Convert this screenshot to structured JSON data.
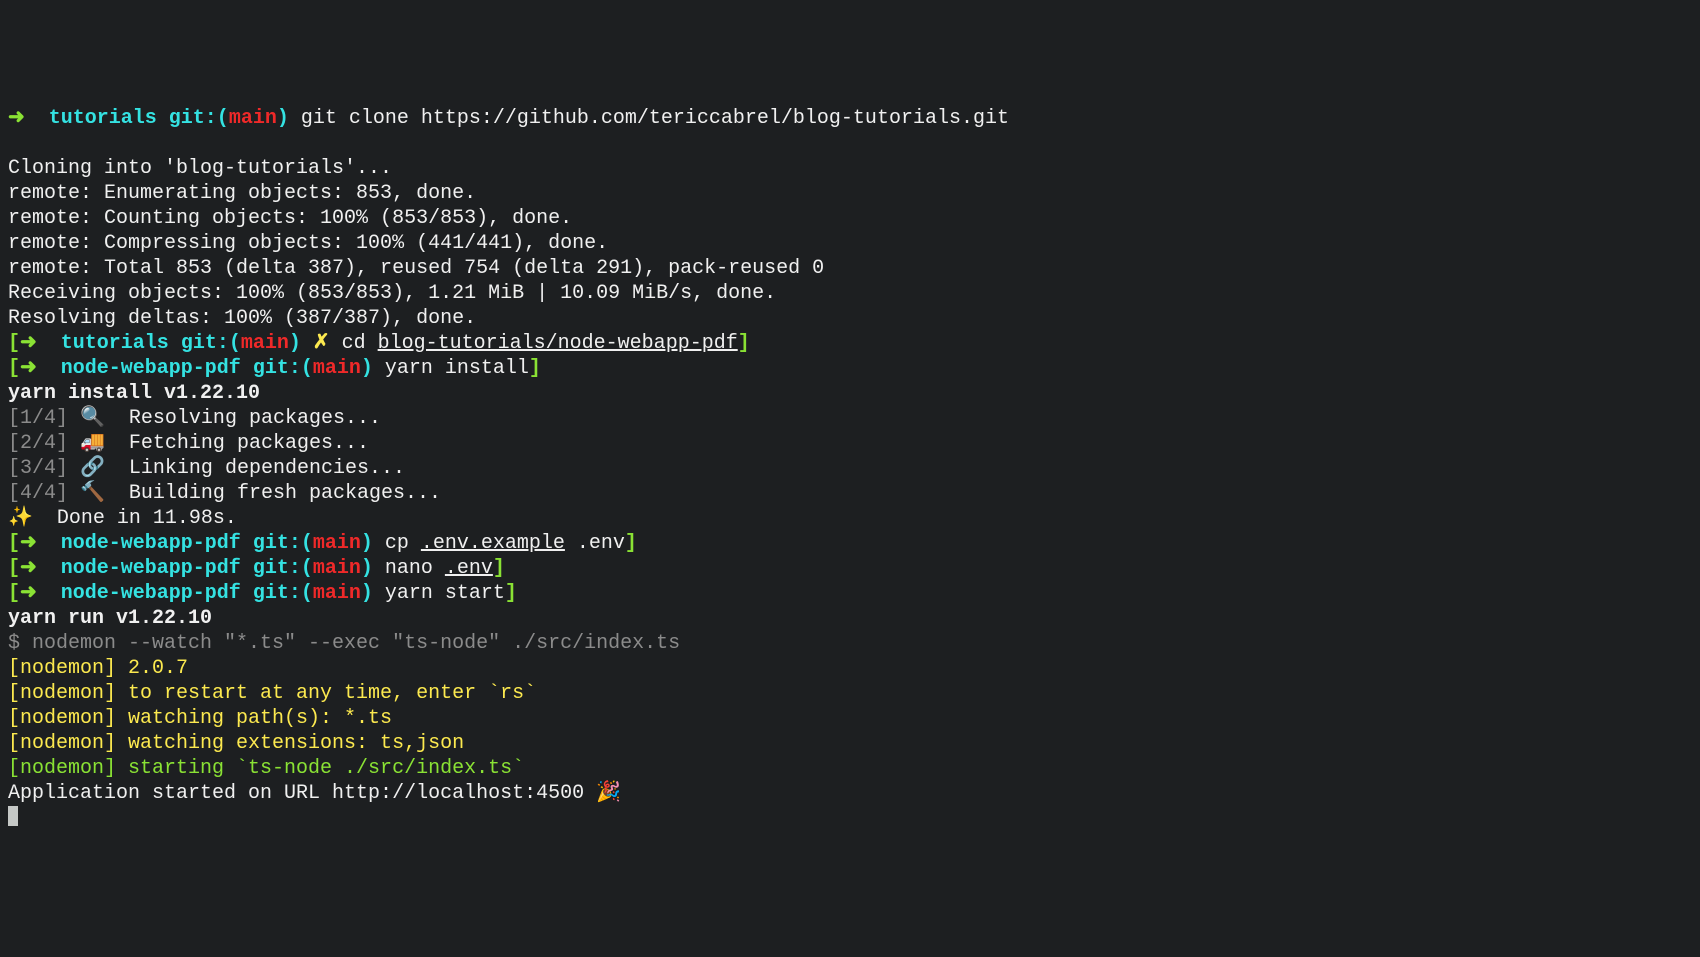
{
  "p1": {
    "arrow": "➜  ",
    "dir": "tutorials ",
    "git": "git:(",
    "branch": "main",
    "close": ") ",
    "cmd": "git clone https://github.com/tericcabrel/blog-tutorials.git"
  },
  "o_blank": "",
  "o1": "Cloning into 'blog-tutorials'...",
  "o2": "remote: Enumerating objects: 853, done.",
  "o3": "remote: Counting objects: 100% (853/853), done.",
  "o4": "remote: Compressing objects: 100% (441/441), done.",
  "o5": "remote: Total 853 (delta 387), reused 754 (delta 291), pack-reused 0",
  "o6": "Receiving objects: 100% (853/853), 1.21 MiB | 10.09 MiB/s, done.",
  "o7": "Resolving deltas: 100% (387/387), done.",
  "p2": {
    "bo": "[",
    "arrow": "➜  ",
    "dir": "tutorials ",
    "git": "git:(",
    "branch": "main",
    "close": ") ",
    "dirty": "✗ ",
    "cmd_a": "cd ",
    "cmd_b": "blog-tutorials/node-webapp-pdf",
    "bc": "]"
  },
  "p3": {
    "bo": "[",
    "arrow": "➜  ",
    "dir": "node-webapp-pdf ",
    "git": "git:(",
    "branch": "main",
    "close": ") ",
    "cmd": "yarn install",
    "bc": "]"
  },
  "y_inst": "yarn install v1.22.10",
  "y1": {
    "step": "[1/4] ",
    "emoji": "🔍  ",
    "txt": "Resolving packages..."
  },
  "y2": {
    "step": "[2/4] ",
    "emoji": "🚚  ",
    "txt": "Fetching packages..."
  },
  "y3": {
    "step": "[3/4] ",
    "emoji": "🔗  ",
    "txt": "Linking dependencies..."
  },
  "y4": {
    "step": "[4/4] ",
    "emoji": "🔨  ",
    "txt": "Building fresh packages..."
  },
  "y_done": {
    "emoji": "✨  ",
    "txt": "Done in 11.98s."
  },
  "p4": {
    "bo": "[",
    "arrow": "➜  ",
    "dir": "node-webapp-pdf ",
    "git": "git:(",
    "branch": "main",
    "close": ") ",
    "cmd_a": "cp ",
    "cmd_b": ".env.example",
    "cmd_c": " .env",
    "bc": "]"
  },
  "p5": {
    "bo": "[",
    "arrow": "➜  ",
    "dir": "node-webapp-pdf ",
    "git": "git:(",
    "branch": "main",
    "close": ") ",
    "cmd_a": "nano ",
    "cmd_b": ".env",
    "bc": "]"
  },
  "p6": {
    "bo": "[",
    "arrow": "➜  ",
    "dir": "node-webapp-pdf ",
    "git": "git:(",
    "branch": "main",
    "close": ") ",
    "cmd": "yarn start",
    "bc": "]"
  },
  "y_run": "yarn run v1.22.10",
  "nm_cmd": "$ nodemon --watch \"*.ts\" --exec \"ts-node\" ./src/index.ts",
  "nm1": "[nodemon] 2.0.7",
  "nm2": "[nodemon] to restart at any time, enter `rs`",
  "nm3": "[nodemon] watching path(s): *.ts",
  "nm4": "[nodemon] watching extensions: ts,json",
  "nm5": "[nodemon] starting `ts-node ./src/index.ts`",
  "app": {
    "txt": "Application started on URL http://localhost:4500 ",
    "emoji": "🎉"
  }
}
